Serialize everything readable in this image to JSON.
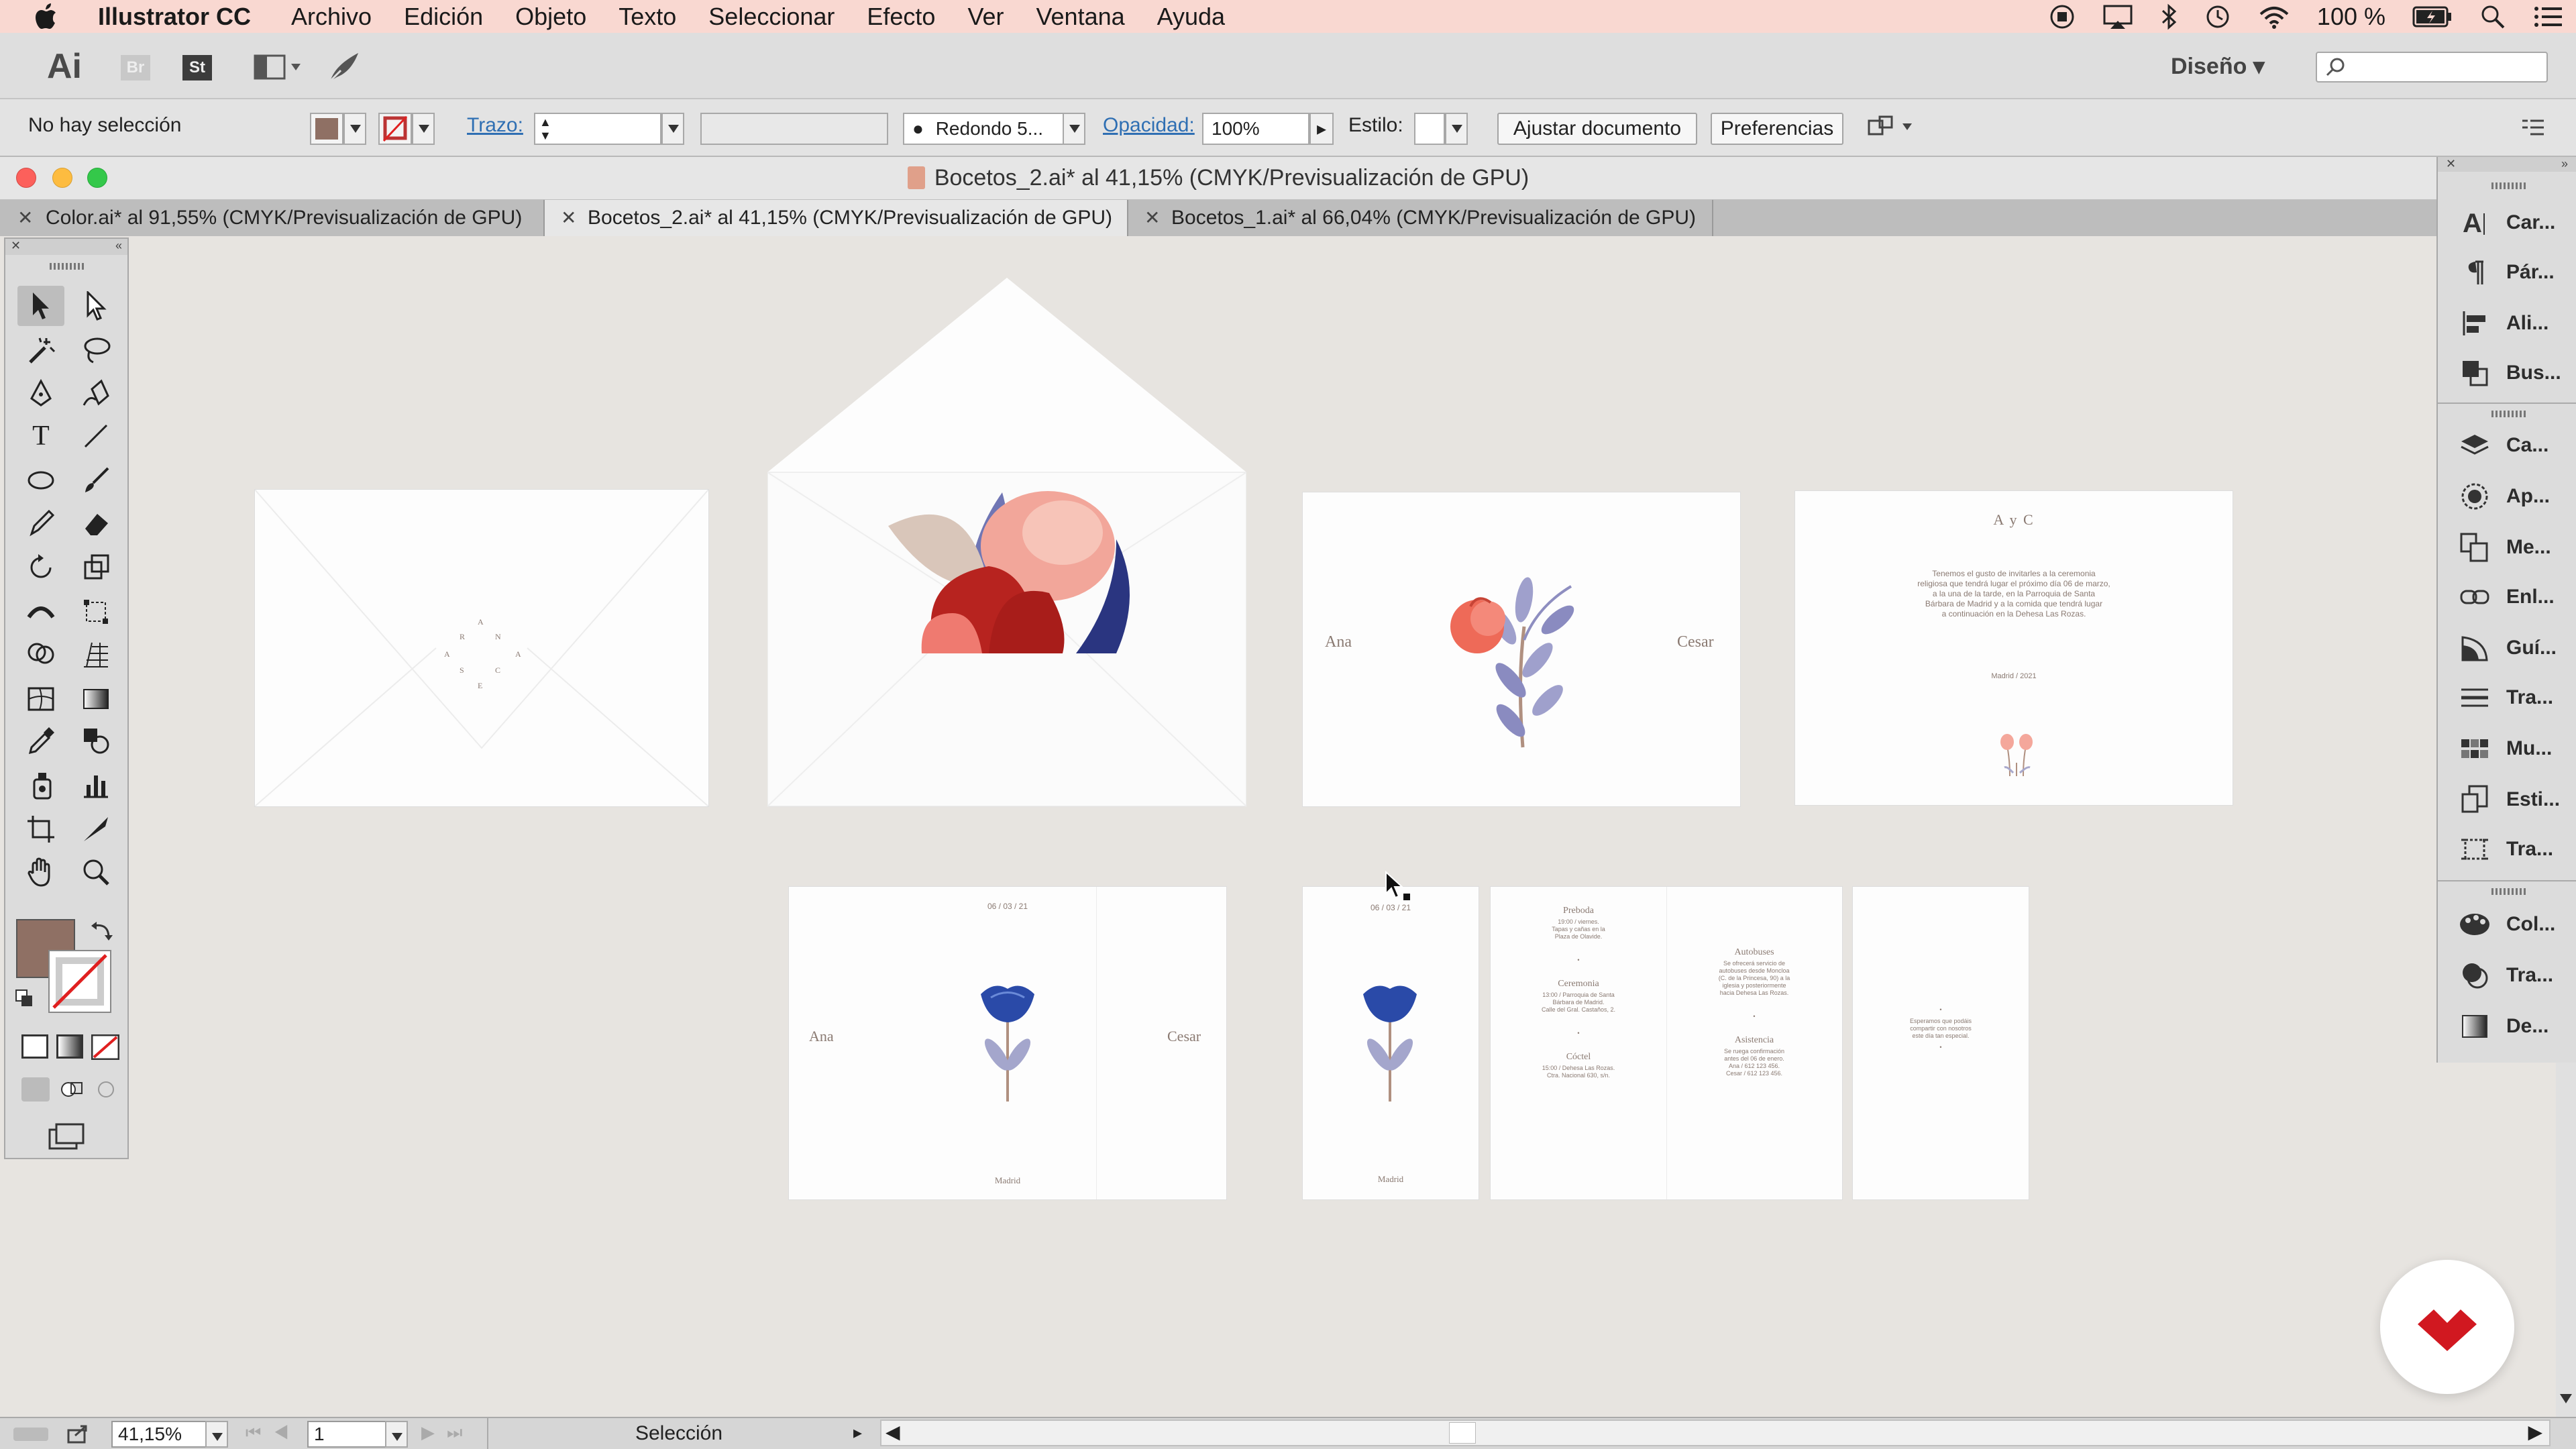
{
  "menubar": {
    "app_name": "Illustrator CC",
    "items": [
      "Archivo",
      "Edición",
      "Objeto",
      "Texto",
      "Seleccionar",
      "Efecto",
      "Ver",
      "Ventana",
      "Ayuda"
    ],
    "battery": "100 %"
  },
  "appbar": {
    "ai_label": "Ai",
    "br_label": "Br",
    "st_label": "St",
    "workspace": "Diseño"
  },
  "control": {
    "selection_status": "No hay selección",
    "stroke_label": "Trazo:",
    "brush_label": "Redondo 5...",
    "opacity_label": "Opacidad:",
    "opacity_value": "100%",
    "style_label": "Estilo:",
    "fit_document": "Ajustar documento",
    "preferences": "Preferencias"
  },
  "document": {
    "window_title": "Bocetos_2.ai* al 41,15% (CMYK/Previsualización de GPU)",
    "tabs": [
      {
        "label": "Color.ai* al 91,55% (CMYK/Previsualización de GPU)"
      },
      {
        "label": "Bocetos_2.ai* al 41,15% (CMYK/Previsualización de GPU)"
      },
      {
        "label": "Bocetos_1.ai* al 66,04% (CMYK/Previsualización de GPU)"
      }
    ]
  },
  "panels": [
    {
      "label": "Car...",
      "icon": "character-icon"
    },
    {
      "label": "Pár...",
      "icon": "paragraph-icon"
    },
    {
      "label": "Ali...",
      "icon": "align-icon"
    },
    {
      "label": "Bus...",
      "icon": "pathfinder-icon"
    },
    {
      "label": "Ca...",
      "icon": "layers-icon"
    },
    {
      "label": "Ap...",
      "icon": "appearance-icon"
    },
    {
      "label": "Me...",
      "icon": "artboards-icon"
    },
    {
      "label": "Enl...",
      "icon": "links-icon"
    },
    {
      "label": "Guí...",
      "icon": "graphic-styles-icon"
    },
    {
      "label": "Tra...",
      "icon": "stroke-icon"
    },
    {
      "label": "Mu...",
      "icon": "swatches-icon"
    },
    {
      "label": "Esti...",
      "icon": "symbols-icon"
    },
    {
      "label": "Tra...",
      "icon": "transform-icon"
    },
    {
      "label": "Col...",
      "icon": "color-icon"
    },
    {
      "label": "Tra...",
      "icon": "transparency-icon"
    },
    {
      "label": "De...",
      "icon": "gradient-icon"
    }
  ],
  "artboards": {
    "envelope_back_letters": [
      "A",
      "R",
      "N",
      "A",
      "A",
      "S",
      "C",
      "E"
    ],
    "card_names": {
      "left": "Ana",
      "right": "Cesar"
    },
    "invite_heading": "A y C",
    "invite_body": [
      "Tenemos el gusto de invitarles a la ceremonia",
      "religiosa que tendrá lugar el próximo día 06 de marzo,",
      "a la una de la tarde, en la Parroquia de Santa",
      "Bárbara de Madrid y a la comida que tendrá lugar",
      "a continuación en la Dehesa Las Rozas."
    ],
    "invite_footer": "Madrid / 2021",
    "date_label": "06 / 03 / 21",
    "city_label": "Madrid",
    "schedule": [
      {
        "title": "Preboda",
        "lines": [
          "19:00 / viernes.",
          "Tapas y cañas en la",
          "Plaza de Olavide."
        ]
      },
      {
        "title": "Ceremonia",
        "lines": [
          "13:00 / Parroquia de Santa",
          "Bárbara de Madrid.",
          "Calle del Gral. Castaños, 2."
        ]
      },
      {
        "title": "Cóctel",
        "lines": [
          "15:00 / Dehesa Las Rozas.",
          "Ctra. Nacional 630, s/n."
        ]
      },
      {
        "title": "Autobuses",
        "lines": [
          "Se ofrecerá servicio de",
          "autobuses desde Moncloa",
          "(C. de la Princesa, 90) a la",
          "iglesia y posteriormente",
          "hacia Dehesa Las Rozas."
        ]
      },
      {
        "title": "Asistencia",
        "lines": [
          "Se ruega confirmación",
          "antes del 06 de enero.",
          "Ana / 612 123 456.",
          "Cesar / 612 123 456."
        ]
      }
    ],
    "closing_note": [
      "Esperamos que podáis",
      "compartir con nosotros",
      "este día tan especial."
    ]
  },
  "status": {
    "zoom": "41,15%",
    "artboard": "1",
    "tool": "Selección"
  },
  "colors": {
    "fill": "#8f7064",
    "menubar": "#f9d8d1",
    "link": "#2f6fb3",
    "brand": "#d11820"
  }
}
